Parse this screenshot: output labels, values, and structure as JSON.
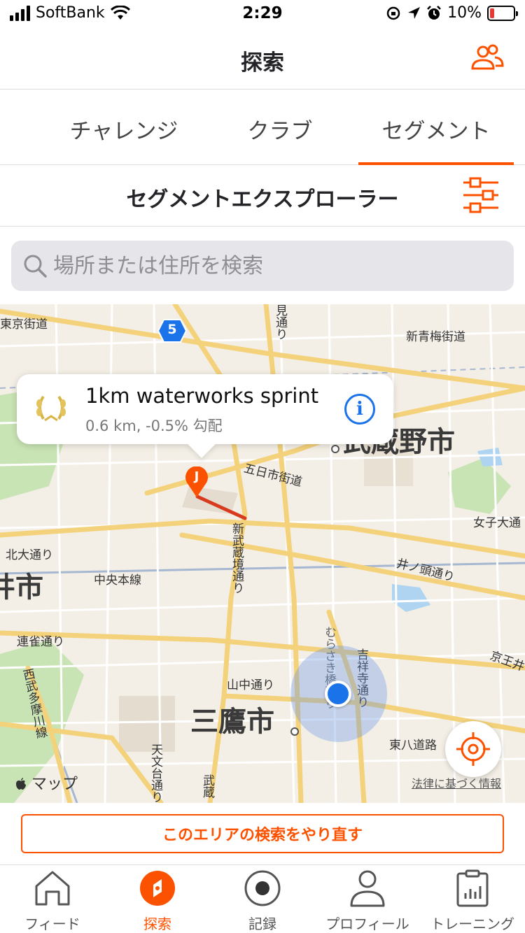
{
  "status_bar": {
    "carrier": "SoftBank",
    "time": "2:29",
    "battery": "10%"
  },
  "nav": {
    "title": "探索"
  },
  "tabs": [
    {
      "label": "チャレンジ"
    },
    {
      "label": "クラブ"
    },
    {
      "label": "セグメント"
    }
  ],
  "explorer": {
    "title": "セグメントエクスプローラー"
  },
  "search": {
    "placeholder": "場所または住所を検索"
  },
  "map": {
    "callout": {
      "title": "1km waterworks sprint",
      "subtitle": "0.6 km, -0.5% 勾配",
      "info": "i"
    },
    "pin_label": "J",
    "route_number": "5",
    "labels": {
      "tokyo_kaido": "東京街道",
      "shin_ome": "新青梅街道",
      "musashino": "武蔵野市",
      "itsukaichi": "五日市街道",
      "joshi": "女子大通",
      "kitaoh": "北大通り",
      "chuo": "中央本線",
      "inokashira": "井ノ頭通り",
      "shi": "井市",
      "renjaku": "連雀通り",
      "yamanaka": "山中通り",
      "mitaka": "三鷹市",
      "higashi_hachi": "東八道路",
      "keio": "京王井",
      "mi": "見通り",
      "shin_musashi": "新武蔵境通り",
      "kichijoji": "吉祥寺通り",
      "murasaki": "むらさき橋通り",
      "nishi_tama": "西武多摩川線",
      "tenmon": "天文台通り",
      "musashi": "武蔵"
    },
    "apple_maps": "マップ",
    "legal": "法律に基づく情報"
  },
  "redo_button": "このエリアの検索をやり直す",
  "tabbar": [
    {
      "label": "フィード"
    },
    {
      "label": "探索"
    },
    {
      "label": "記録"
    },
    {
      "label": "プロフィール"
    },
    {
      "label": "トレーニング"
    }
  ],
  "colors": {
    "accent": "#fc5200",
    "link": "#1a73e8"
  }
}
